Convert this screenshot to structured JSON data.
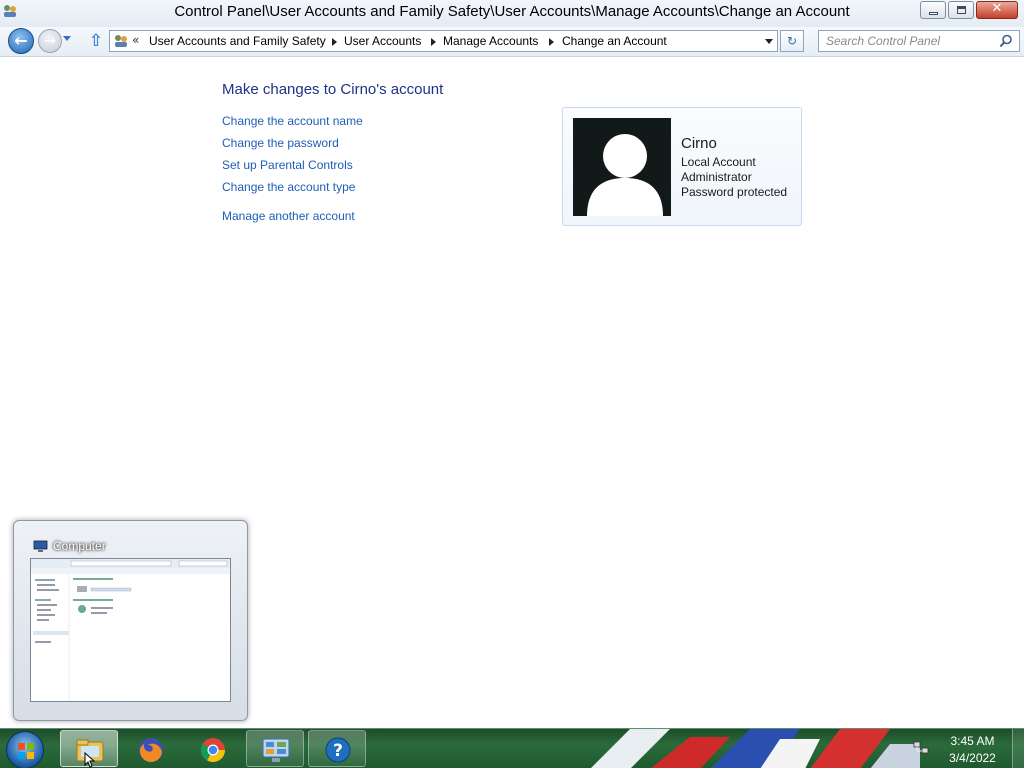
{
  "window": {
    "title": "Control Panel\\User Accounts and Family Safety\\User Accounts\\Manage Accounts\\Change an Account",
    "minimize_icon": "minimize-icon",
    "maximize_icon": "maximize-icon",
    "close_icon": "close-icon",
    "close_glyph": "✕"
  },
  "nav": {
    "back_glyph": "←",
    "forward_glyph": "→",
    "up_glyph": "⇧",
    "refresh_glyph": "↻",
    "breadcrumb_chevron": "«",
    "breadcrumbs": [
      "User Accounts and Family Safety",
      "User Accounts",
      "Manage Accounts",
      "Change an Account"
    ],
    "search_placeholder": "Search Control Panel"
  },
  "main": {
    "heading": "Make changes to Cirno's account",
    "tasks": [
      "Change the account name",
      "Change the password",
      "Set up Parental Controls",
      "Change the account type",
      "Manage another account"
    ]
  },
  "account": {
    "name": "Cirno",
    "details": [
      "Local Account",
      "Administrator",
      "Password protected"
    ]
  },
  "thumbnail": {
    "title": "Computer"
  },
  "taskbar": {
    "items": [
      {
        "name": "windows-explorer",
        "icon": "folder-icon",
        "state": "active"
      },
      {
        "name": "firefox",
        "icon": "firefox-icon",
        "state": "normal"
      },
      {
        "name": "chrome",
        "icon": "chrome-icon",
        "state": "normal"
      },
      {
        "name": "control-panel",
        "icon": "control-panel-icon",
        "state": "pinned"
      },
      {
        "name": "help",
        "icon": "help-icon",
        "state": "pinned"
      }
    ],
    "clock_time": "3:45 AM",
    "clock_date": "3/4/2022"
  },
  "colors": {
    "link": "#1e5eb6",
    "heading": "#1e3287",
    "taskbar": "#2b6b3a",
    "card_border": "#c9d9ec"
  }
}
